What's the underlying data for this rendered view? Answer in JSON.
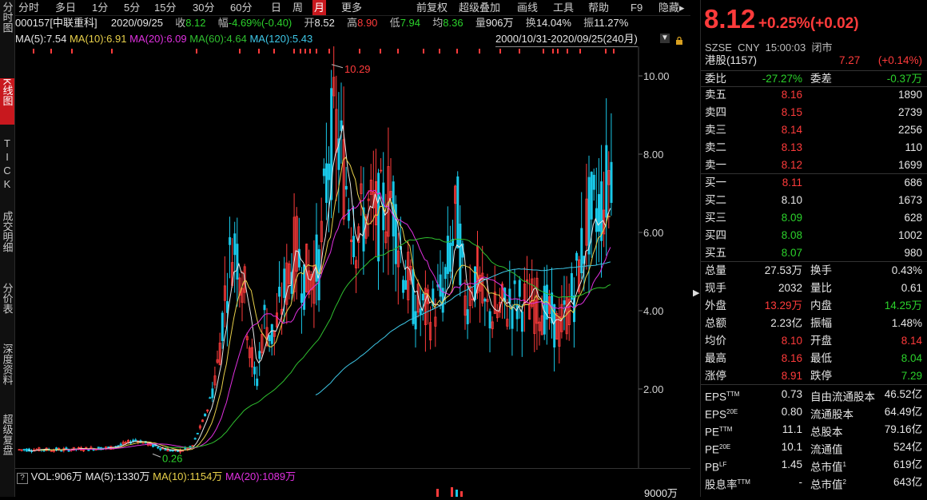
{
  "left_tabs": [
    "分时图",
    "K线图",
    "TICK",
    "成交明细",
    "分价表",
    "深度资料",
    "超级复盘"
  ],
  "periods": [
    "分时",
    "多日",
    "1分",
    "5分",
    "15分",
    "30分",
    "60分",
    "日",
    "周",
    "月",
    "更多"
  ],
  "active_period": "月",
  "tools": [
    "前复权",
    "超级叠加",
    "画线",
    "工具",
    "帮助",
    "F9",
    "隐藏▸"
  ],
  "info": {
    "code_name": "000157[中联重科]",
    "date": "2020/09/25",
    "close_label": "收",
    "close": "8.12",
    "change_label": "幅",
    "change": "-4.69%(-0.40)",
    "open_label": "开",
    "open": "8.52",
    "high_label": "高",
    "high": "8.90",
    "low_label": "低",
    "low": "7.94",
    "avg_label": "均",
    "avg": "8.36",
    "vol_label": "量",
    "vol": "906万",
    "turnover_label": "换",
    "turnover": "14.04%",
    "amp_label": "振",
    "amp": "11.27%"
  },
  "ma": {
    "ma5": "MA(5):7.54",
    "ma10": "MA(10):6.91",
    "ma20": "MA(20):6.09",
    "ma60": "MA(60):4.64",
    "ma120": "MA(120):5.43",
    "range": "2000/10/31-2020/09/25(240月)"
  },
  "volume_line": {
    "vol": "VOL:906万",
    "ma5": "MA(5):1330万",
    "ma10": "MA(10):1154万",
    "ma20": "MA(20):1089万",
    "axis_label": "9000万"
  },
  "chart_data": {
    "type": "candlestick",
    "y_ticks": [
      "10.00",
      "8.00",
      "6.00",
      "4.00",
      "2.00"
    ],
    "ylim": [
      0.0,
      10.5
    ],
    "annotations": {
      "max": "10.29",
      "min": "0.26"
    },
    "colors": {
      "up": "#ff3b3b",
      "down": "#19c8e8",
      "ma5": "#e8e8e8",
      "ma10": "#e8d04a",
      "ma20": "#e030e0",
      "ma60": "#2fc02f",
      "ma120": "#3ec8e8"
    }
  },
  "quote": {
    "price": "8.12",
    "change": "+0.25%(+0.02)",
    "market": "SZSE  CNY  15:00:03  闭市",
    "hk_label": "港股(1157)",
    "hk_price": "7.27",
    "hk_change": "(+0.14%)",
    "wb_label": "委比",
    "wb": "-27.27%",
    "wc_label": "委差",
    "wc": "-0.37万"
  },
  "order_book": {
    "asks": [
      {
        "label": "卖五",
        "price": "8.16",
        "vol": "1890"
      },
      {
        "label": "卖四",
        "price": "8.15",
        "vol": "2739"
      },
      {
        "label": "卖三",
        "price": "8.14",
        "vol": "2256"
      },
      {
        "label": "卖二",
        "price": "8.13",
        "vol": "110"
      },
      {
        "label": "卖一",
        "price": "8.12",
        "vol": "1699"
      }
    ],
    "bids": [
      {
        "label": "买一",
        "price": "8.11",
        "vol": "686"
      },
      {
        "label": "买二",
        "price": "8.10",
        "vol": "1673"
      },
      {
        "label": "买三",
        "price": "8.09",
        "vol": "628"
      },
      {
        "label": "买四",
        "price": "8.08",
        "vol": "1002"
      },
      {
        "label": "买五",
        "price": "8.07",
        "vol": "980"
      }
    ]
  },
  "stats": [
    {
      "l1": "总量",
      "v1": "27.53万",
      "l2": "换手",
      "v2": "0.43%"
    },
    {
      "l1": "现手",
      "v1": "2032",
      "l2": "量比",
      "v2": "0.61"
    },
    {
      "l1": "外盘",
      "v1": "13.29万",
      "l2": "内盘",
      "v2": "14.25万"
    },
    {
      "l1": "总额",
      "v1": "2.23亿",
      "l2": "振幅",
      "v2": "1.48%"
    },
    {
      "l1": "均价",
      "v1": "8.10",
      "l2": "开盘",
      "v2": "8.14"
    },
    {
      "l1": "最高",
      "v1": "8.16",
      "l2": "最低",
      "v2": "8.04"
    },
    {
      "l1": "涨停",
      "v1": "8.91",
      "l2": "跌停",
      "v2": "7.29"
    }
  ],
  "fund": [
    {
      "l1": "EPS",
      "s1": "TTM",
      "v1": "0.73",
      "l2": "自由流通股本",
      "s2": "",
      "v2": "46.52亿"
    },
    {
      "l1": "EPS",
      "s1": "20E",
      "v1": "0.80",
      "l2": "流通股本",
      "s2": "",
      "v2": "64.49亿"
    },
    {
      "l1": "PE",
      "s1": "TTM",
      "v1": "11.1",
      "l2": "总股本",
      "s2": "",
      "v2": "79.16亿"
    },
    {
      "l1": "PE",
      "s1": "20E",
      "v1": "10.1",
      "l2": "流通值",
      "s2": "",
      "v2": "524亿"
    },
    {
      "l1": "PB",
      "s1": "LF",
      "v1": "1.45",
      "l2": "总市值",
      "s2": "1",
      "v2": "619亿"
    },
    {
      "l1": "股息率",
      "s1": "TTM",
      "v1": "-",
      "l2": "总市值",
      "s2": "2",
      "v2": "643亿"
    }
  ]
}
